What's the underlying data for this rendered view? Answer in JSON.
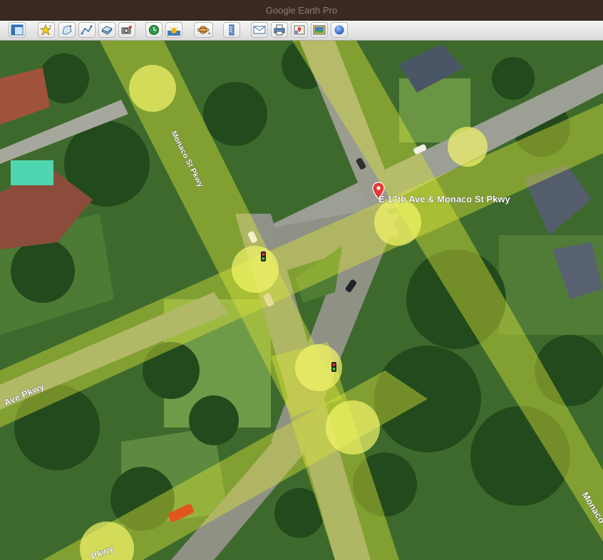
{
  "window": {
    "title": "Google Earth Pro"
  },
  "toolbar": {
    "buttons": [
      {
        "name": "sidebar-toggle-button",
        "icon": "sidebar-icon"
      },
      {
        "name": "add-placemark-button",
        "icon": "placemark-pin-icon"
      },
      {
        "name": "add-polygon-button",
        "icon": "polygon-icon"
      },
      {
        "name": "add-path-button",
        "icon": "path-icon"
      },
      {
        "name": "add-image-overlay-button",
        "icon": "image-overlay-icon"
      },
      {
        "name": "record-tour-button",
        "icon": "record-tour-icon"
      },
      {
        "name": "historical-imagery-button",
        "icon": "clock-icon"
      },
      {
        "name": "sunlight-button",
        "icon": "sun-icon"
      },
      {
        "name": "planets-button",
        "icon": "planet-icon"
      },
      {
        "name": "ruler-button",
        "icon": "ruler-icon"
      },
      {
        "name": "email-button",
        "icon": "envelope-icon"
      },
      {
        "name": "print-button",
        "icon": "printer-icon"
      },
      {
        "name": "view-in-maps-button",
        "icon": "map-icon"
      },
      {
        "name": "save-image-button",
        "icon": "save-image-icon"
      },
      {
        "name": "earth-view-button",
        "icon": "globe-icon"
      }
    ]
  },
  "map": {
    "placemark": {
      "label": "E 17th Ave & Monaco St Pkwy",
      "icon": "red-pin-icon"
    },
    "road_labels": {
      "monaco_north": "Monaco St Pkwy",
      "ave_west": "Ave Pkwy",
      "pkwy_south": "Pkwy",
      "monaco_southeast": "Monaco"
    },
    "colors": {
      "road_overlay": "#d8e23a",
      "highlight_circle": "#f4f56a",
      "vegetation": "#3f6a2e",
      "pin": "#e53935"
    }
  }
}
